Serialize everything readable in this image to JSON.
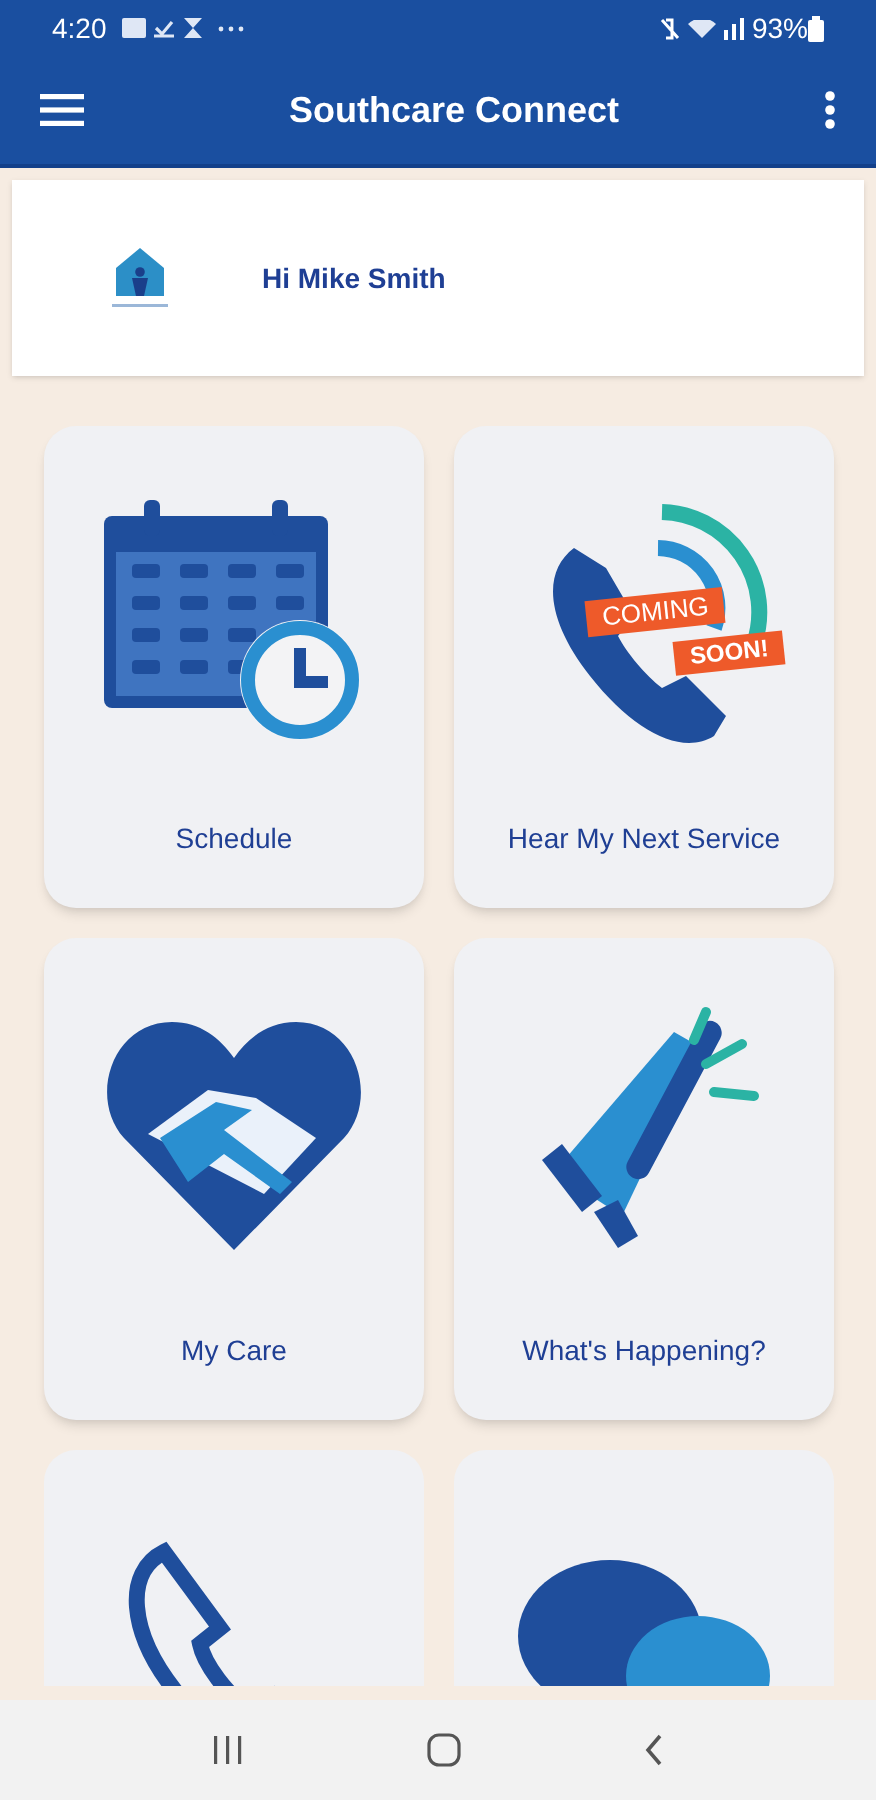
{
  "status_bar": {
    "time": "4:20",
    "battery": "93%"
  },
  "app_bar": {
    "title": "Southcare Connect"
  },
  "greeting": {
    "text": "Hi Mike Smith"
  },
  "tiles": [
    {
      "kind": "calendar",
      "label": "Schedule"
    },
    {
      "kind": "coming-soon",
      "label": "Hear My Next Service",
      "badge": [
        "COMING",
        "SOON!"
      ]
    },
    {
      "kind": "heart",
      "label": "My Care"
    },
    {
      "kind": "megaphone",
      "label": "What's Happening?"
    },
    {
      "kind": "phone"
    },
    {
      "kind": "chat"
    }
  ]
}
